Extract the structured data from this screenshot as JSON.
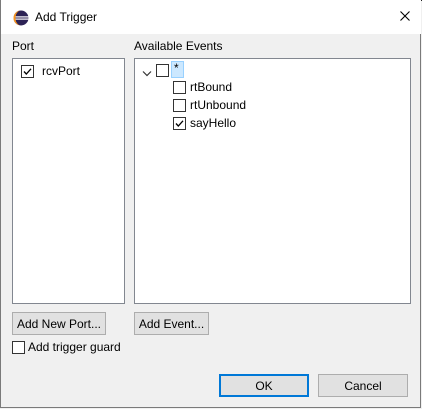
{
  "window": {
    "title": "Add Trigger",
    "close_glyph": "✕"
  },
  "port": {
    "label": "Port",
    "items": [
      {
        "label": "rcvPort",
        "checked": true
      }
    ],
    "add_button": "Add New Port..."
  },
  "events": {
    "label": "Available Events",
    "root": {
      "label": "*",
      "checked": false,
      "expanded": true
    },
    "items": [
      {
        "label": "rtBound",
        "checked": false
      },
      {
        "label": "rtUnbound",
        "checked": false
      },
      {
        "label": "sayHello",
        "checked": true
      }
    ],
    "add_button": "Add Event..."
  },
  "guard": {
    "label": "Add trigger guard",
    "checked": false
  },
  "footer": {
    "ok": "OK",
    "cancel": "Cancel"
  },
  "colors": {
    "accent": "#0078d7",
    "selection": "#cce8ff"
  },
  "icons": [
    "eclipse-icon",
    "close-icon",
    "chevron-down-icon",
    "checkbox-checked-icon",
    "checkbox-empty-icon"
  ]
}
